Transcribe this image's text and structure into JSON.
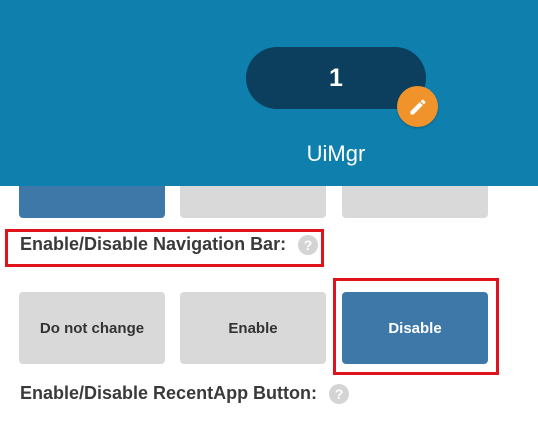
{
  "header": {
    "counter_value": "1",
    "title": "UiMgr",
    "edit_icon": "pencil-icon"
  },
  "top_row": {
    "buttons": [
      "",
      "",
      ""
    ],
    "selected_index": 0
  },
  "navigation_bar": {
    "label": "Enable/Disable Navigation Bar:",
    "help_icon": "question-icon",
    "help_glyph": "?",
    "options": [
      "Do not change",
      "Enable",
      "Disable"
    ],
    "selected": "Disable"
  },
  "recent_app": {
    "label": "Enable/Disable RecentApp Button:",
    "help_icon": "question-icon",
    "help_glyph": "?"
  },
  "colors": {
    "header_bg": "#0f7fae",
    "pill_bg": "#0b3f5d",
    "edit_badge": "#f0932b",
    "selected_button": "#3e78a8",
    "unselected_button": "#d9d9d9",
    "annotation_red": "#e0121b"
  }
}
